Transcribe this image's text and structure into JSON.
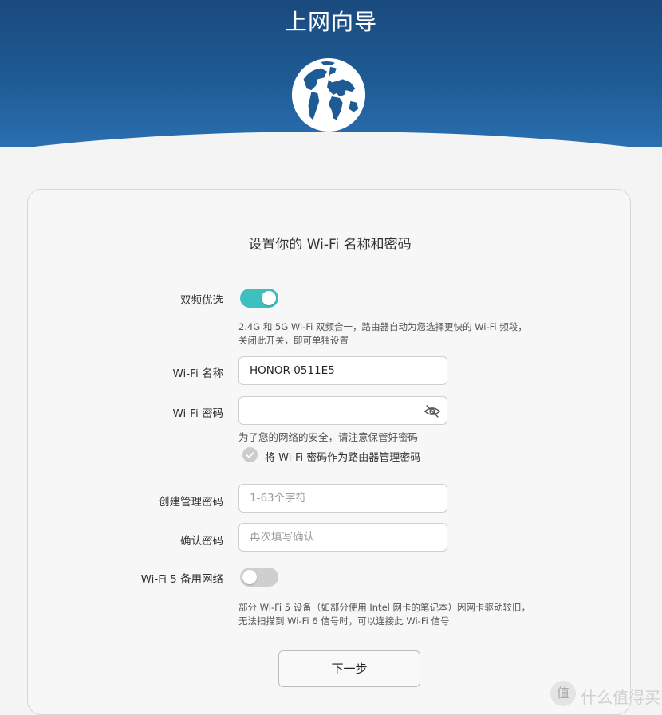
{
  "header": {
    "title": "上网向导",
    "globe_icon": "globe-icon",
    "color": "#1e5b95"
  },
  "card": {
    "title": "设置你的 Wi-Fi 名称和密码",
    "dual_band": {
      "label": "双频优选",
      "enabled": true,
      "hint": "2.4G 和 5G Wi-Fi 双频合一，路由器自动为您选择更快的 Wi-Fi 频段，关闭此开关，即可单独设置",
      "accent": "#3ec0be"
    },
    "wifi_name": {
      "label": "Wi-Fi 名称",
      "value": "HONOR-0511E5",
      "placeholder": ""
    },
    "wifi_password": {
      "label": "Wi-Fi 密码",
      "value": "",
      "placeholder": "",
      "icon": "eye-slash-icon",
      "hint": "为了您的网络的安全，请注意保管好密码"
    },
    "use_as_admin": {
      "label": "将 Wi-Fi 密码作为路由器管理密码",
      "checked": false
    },
    "admin_password": {
      "label": "创建管理密码",
      "value": "",
      "placeholder": "1-63个字符"
    },
    "confirm_password": {
      "label": "确认密码",
      "value": "",
      "placeholder": "再次填写确认"
    },
    "wifi5_backup": {
      "label": "Wi-Fi 5 备用网络",
      "enabled": false,
      "hint": "部分 Wi-Fi 5 设备（如部分使用 Intel 网卡的笔记本）因网卡驱动较旧，无法扫描到 Wi-Fi 6 信号时，可以连接此 Wi-Fi 信号"
    },
    "next_label": "下一步"
  },
  "watermark": {
    "badge": "值",
    "text": "什么值得买"
  }
}
